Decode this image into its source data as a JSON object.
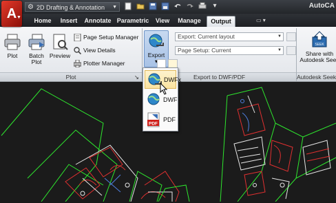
{
  "app": {
    "logo_letter": "A",
    "workspace": "2D Drafting & Annotation",
    "title": "AutoCA"
  },
  "tabs": [
    {
      "label": "Home",
      "active": false
    },
    {
      "label": "Insert",
      "active": false
    },
    {
      "label": "Annotate",
      "active": false
    },
    {
      "label": "Parametric",
      "active": false
    },
    {
      "label": "View",
      "active": false
    },
    {
      "label": "Manage",
      "active": false
    },
    {
      "label": "Output",
      "active": true
    }
  ],
  "plot_panel": {
    "plot_label": "Plot",
    "batch_plot_line1": "Batch",
    "batch_plot_line2": "Plot",
    "preview_label": "Preview",
    "page_setup_manager": "Page Setup Manager",
    "view_details": "View Details",
    "plotter_manager": "Plotter Manager",
    "footer": "Plot",
    "footer_arrow": "↘"
  },
  "export_panel": {
    "export_label": "Export",
    "export_arrow": "▾",
    "export_combo": "Export: Current layout",
    "page_setup_combo": "Page Setup: Current",
    "footer": "Export to DWF/PDF"
  },
  "seek_panel": {
    "share_line1": "Share with",
    "share_line2": "Autodesk Seek",
    "footer": "Autodesk Seek"
  },
  "export_menu": [
    {
      "label": "DWFx",
      "highlighted": true
    },
    {
      "label": "DWF",
      "highlighted": false
    },
    {
      "label": "PDF",
      "highlighted": false
    }
  ],
  "pdf_icon_text": "PDF",
  "colors": {
    "drawing_bg": "#1b1b1b",
    "lines_green": "#2ee82e",
    "lines_red": "#e03030",
    "lines_white": "#e8e8e8",
    "ribbon_bg": "#eceef1",
    "menu_highlight": "#fbe3a0"
  }
}
